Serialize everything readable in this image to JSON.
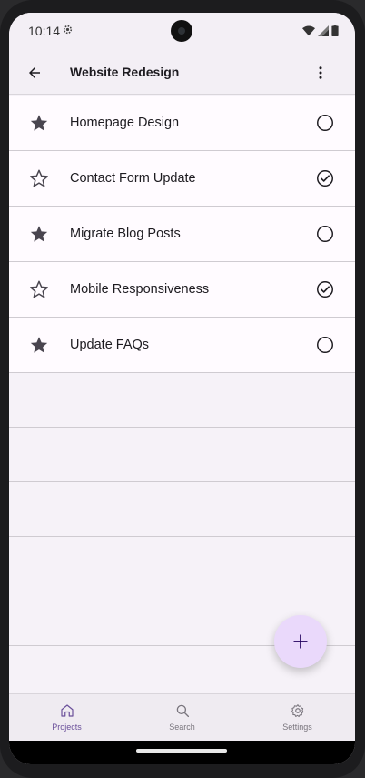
{
  "status_bar": {
    "time": "10:14"
  },
  "app_bar": {
    "title": "Website Redesign"
  },
  "tasks": [
    {
      "label": "Homepage Design",
      "starred": true,
      "completed": false
    },
    {
      "label": "Contact Form Update",
      "starred": false,
      "completed": true
    },
    {
      "label": "Migrate Blog Posts",
      "starred": true,
      "completed": false
    },
    {
      "label": "Mobile Responsiveness",
      "starred": false,
      "completed": true
    },
    {
      "label": "Update FAQs",
      "starred": true,
      "completed": false
    }
  ],
  "bottom_nav": {
    "items": [
      {
        "label": "Projects",
        "icon": "home-icon",
        "active": true
      },
      {
        "label": "Search",
        "icon": "search-icon",
        "active": false
      },
      {
        "label": "Settings",
        "icon": "gear-icon",
        "active": false
      }
    ]
  },
  "colors": {
    "accent": "#6a4f9a",
    "fab_background": "#ead9fb",
    "surface": "#fffbff",
    "background": "#f6f2f8"
  }
}
